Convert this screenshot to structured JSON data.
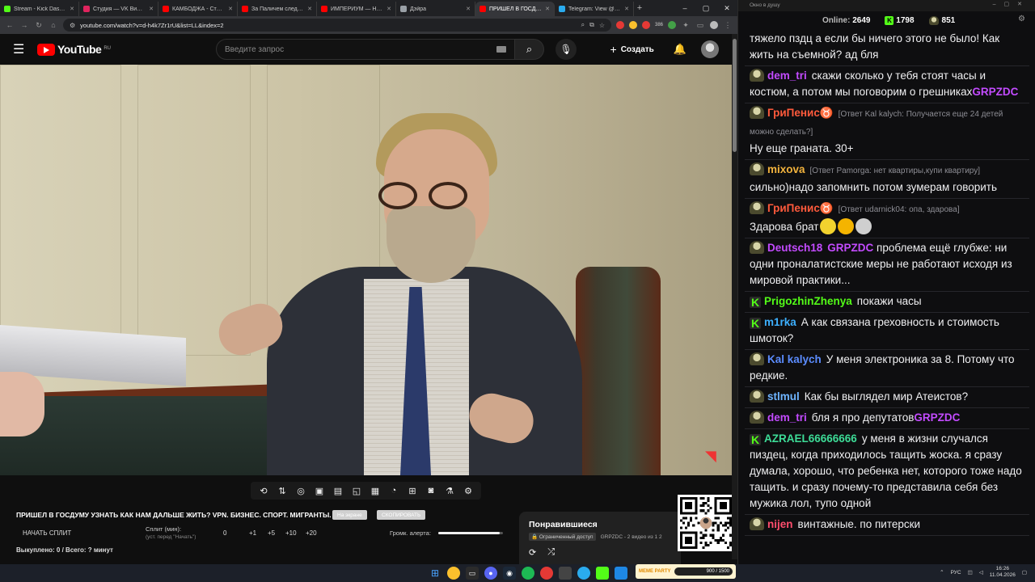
{
  "browser": {
    "tabs": [
      {
        "label": "Stream - Kick Dashboard",
        "color": "#53fc18",
        "active": false
      },
      {
        "label": "Студия — VK Видео Live",
        "color": "#e0245e",
        "active": false
      },
      {
        "label": "КАМБОДЖА - Столица",
        "color": "#ff0000",
        "active": false
      },
      {
        "label": "За Паличем следят в реале",
        "color": "#ff0000",
        "active": false
      },
      {
        "label": "ИМПЕРИУМ — НЕ РОЯЛЬ",
        "color": "#ff0000",
        "active": false
      },
      {
        "label": "Дэйра",
        "color": "#9aa0a6",
        "active": false
      },
      {
        "label": "ПРИШЕЛ В ГОСДУМУ",
        "color": "#ff0000",
        "active": true
      },
      {
        "label": "Telegram: View @dvorc",
        "color": "#2aabee",
        "active": false
      }
    ],
    "url": "youtube.com/watch?v=d-h4k7Zr1rU&list=LL&index=2",
    "badge_count": "386"
  },
  "youtube": {
    "logo_text": "YouTube",
    "region": "RU",
    "search_placeholder": "Введите запрос",
    "create_label": "Создать"
  },
  "player": {
    "title": "ПРИШЕЛ В ГОСДУМУ УЗНАТЬ КАК НАМ ДАЛЬШЕ ЖИТЬ? VPN. БИЗНЕС. СПОРТ. МИГРАНТЫ.",
    "pill1": "На экране",
    "pill2": "СКОПИРОВАТЬ",
    "split_button": "НАЧАТЬ СПЛИТ",
    "split_label": "Сплит (мин):",
    "split_hint": "(уст. перед \"Начать\")",
    "split_values": [
      "0",
      "+1",
      "+5",
      "+10",
      "+20"
    ],
    "alert_label": "Громк. алерта:",
    "alert_level": 0.95,
    "counter": "Выкуплено: 0 / Всего: ? минут"
  },
  "playlist": {
    "title": "Понравившиеся",
    "access": "Ограниченный доступ",
    "meta": "GRPZDC - 2 видео из 1 2"
  },
  "chat": {
    "window_title": "Окно в душу",
    "online_label": "Online:",
    "online_count": "2649",
    "kick_count": "1798",
    "other_count": "851",
    "messages": [
      {
        "nick": "",
        "color": "#fff",
        "reply": "",
        "text": "тяжело пздц а если бы ничего этого не было! Как жить на съемной? ад бля",
        "avatar": "none",
        "mention": ""
      },
      {
        "nick": "dem_tri",
        "color": "#c34bff",
        "reply": "",
        "text": "скажи сколько у тебя стоят часы и костюм, а потом мы поговорим о грешниках",
        "avatar": "img",
        "mention": "GRPZDC"
      },
      {
        "nick": "ГриПенис♉",
        "color": "#ff5a3c",
        "reply": "[Ответ Kal kalych: Получается еще 24 детей можно сделать?]",
        "text": "Ну еще граната. 30+",
        "avatar": "img",
        "mention": ""
      },
      {
        "nick": "mixova",
        "color": "#f2b33d",
        "reply": "[Ответ Pamorga: нет квартиры,купи квартиру]",
        "text": "сильно)надо запомнить потом зумерам говорить",
        "avatar": "img",
        "mention": ""
      },
      {
        "nick": "ГриПенис♉",
        "color": "#ff5a3c",
        "reply": "[Ответ udarnick04: опа, здарова]",
        "text": "Здарова брат",
        "avatar": "img",
        "mention": "",
        "emotes": 3
      },
      {
        "nick": "Deutsch18",
        "color": "#c34bff",
        "reply": "",
        "text": "проблема ещё глубже: ни одни проналатистские меры не работают исходя из мировой практики...",
        "avatar": "img",
        "mention": "GRPZDC",
        "mention_first": true
      },
      {
        "nick": "PrigozhinZhenya",
        "color": "#53fc18",
        "reply": "",
        "text": "покажи часы",
        "avatar": "k",
        "mention": ""
      },
      {
        "nick": "m1rka",
        "color": "#3db0ff",
        "reply": "",
        "text": "А как связана греховность и стоимость шмоток?",
        "avatar": "k",
        "mention": ""
      },
      {
        "nick": "Kal kalych",
        "color": "#5b8cff",
        "reply": "",
        "text": "У меня электроника за 8. Потому что редкие.",
        "avatar": "img",
        "mention": ""
      },
      {
        "nick": "stlmul",
        "color": "#6eb4ff",
        "reply": "",
        "text": "Как бы выглядел мир Атеистов?",
        "avatar": "img",
        "mention": ""
      },
      {
        "nick": "dem_tri",
        "color": "#c34bff",
        "reply": "",
        "text": "бля я про депутатов",
        "avatar": "img",
        "mention": "GRPZDC"
      },
      {
        "nick": "AZRAEL66666666",
        "color": "#3ddc97",
        "reply": "",
        "text": "у меня в жизни случался пиздец, когда приходилось тащить жоска. я сразу думала, хорошо, что ребенка нет, которого тоже надо тащить. и сразу почему-то представила себя без мужика лол, тупо одной",
        "avatar": "k",
        "mention": ""
      },
      {
        "nick": "nijen",
        "color": "#ff4d6d",
        "reply": "",
        "text": "винтажные. по питерски",
        "avatar": "img",
        "mention": ""
      }
    ]
  },
  "taskbar": {
    "meme_label": "MEME PARTY",
    "meme_progress": "900 / 1500",
    "lang": "РУС",
    "time": "16:26",
    "date": "11.04.2026"
  }
}
